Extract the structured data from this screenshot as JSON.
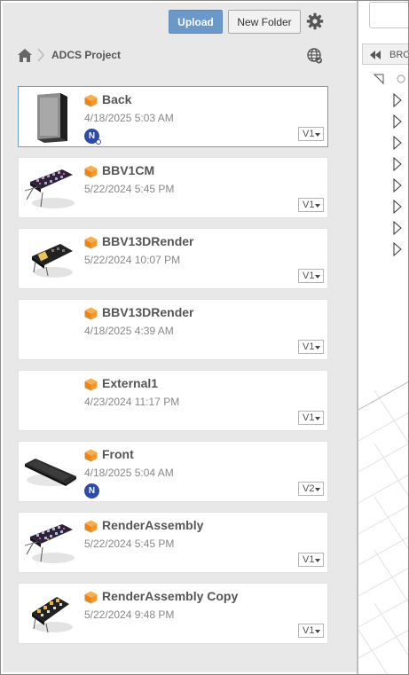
{
  "toolbar": {
    "upload_label": "Upload",
    "new_folder_label": "New Folder",
    "settings_icon": "gear-icon"
  },
  "breadcrumb": {
    "home_icon": "home-icon",
    "project": "ADCS Project",
    "share_icon": "globe-icon"
  },
  "files": [
    {
      "name": "Back",
      "date": "4/18/2025 5:03 AM",
      "version": "V1",
      "badge": "N",
      "thumb": "dark-box",
      "selected": true
    },
    {
      "name": "BBV1CM",
      "date": "5/22/2024 5:45 PM",
      "version": "V1",
      "badge": "",
      "thumb": "board-assembly"
    },
    {
      "name": "BBV13DRender",
      "date": "5/22/2024 10:07 PM",
      "version": "V1",
      "badge": "",
      "thumb": "board-black"
    },
    {
      "name": "BBV13DRender",
      "date": "4/18/2025 4:39 AM",
      "version": "V1",
      "badge": "",
      "thumb": "blank"
    },
    {
      "name": "External1",
      "date": "4/23/2024 11:17 PM",
      "version": "V1",
      "badge": "",
      "thumb": "blank"
    },
    {
      "name": "Front",
      "date": "4/18/2025 5:04 AM",
      "version": "V2",
      "badge": "N",
      "thumb": "dark-plate"
    },
    {
      "name": "RenderAssembly",
      "date": "5/22/2024 5:45 PM",
      "version": "V1",
      "badge": "",
      "thumb": "board-assembly"
    },
    {
      "name": "RenderAssembly Copy",
      "date": "5/22/2024 9:48 PM",
      "version": "V1",
      "badge": "",
      "thumb": "board-yellow"
    }
  ],
  "browser": {
    "label": "BRO"
  },
  "colors": {
    "accent": "#6a98c9",
    "panel": "#e8e8e8",
    "cube": "#f08a24",
    "badge": "#2d4ca6"
  }
}
